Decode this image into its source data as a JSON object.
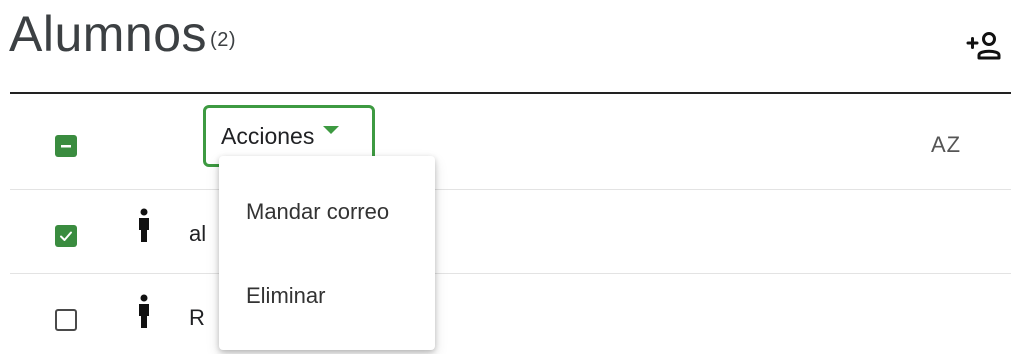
{
  "header": {
    "title": "Alumnos",
    "count": "(2)"
  },
  "toolbar": {
    "actions_label": "Acciones",
    "sort_label": "AZ",
    "icons": {
      "add_user": "add-person-icon",
      "sort": "sort-alpha-icon",
      "select_all": "indeterminate-checkbox-icon"
    }
  },
  "students": [
    {
      "name_partial": "al",
      "checked": true,
      "icon": "person-icon"
    },
    {
      "name_partial": "R",
      "checked": false,
      "icon": "person-icon"
    }
  ],
  "actions_menu": {
    "items": [
      {
        "label": "Mandar correo"
      },
      {
        "label": "Eliminar"
      }
    ]
  },
  "colors": {
    "accent": "#3d9a41",
    "checkbox_fill": "#3a8c3f",
    "divider": "#e3e3e3"
  }
}
